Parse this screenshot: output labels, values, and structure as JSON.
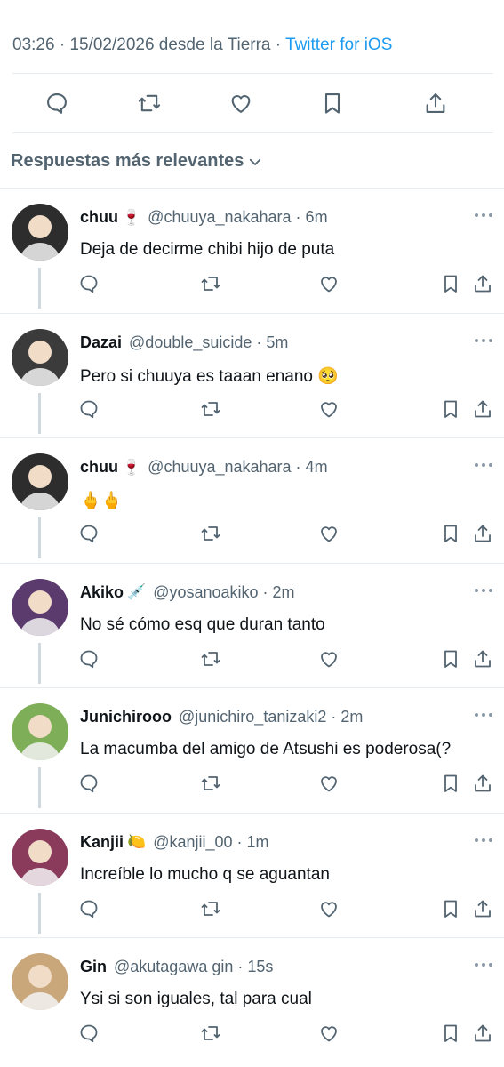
{
  "tweet": {
    "meta": "03:26 · 15/02/2026 desde la Tierra · ",
    "via": "Twitter for iOS"
  },
  "sort": {
    "label": "Respuestas más relevantes"
  },
  "icons": [
    "reply-icon",
    "retweet-icon",
    "like-icon",
    "bookmark-icon",
    "share-icon"
  ],
  "colors": {
    "accent": "#1d9bf0",
    "secondary": "#536471",
    "text": "#0f1419",
    "divider": "#e6ecf0"
  },
  "replies": [
    {
      "name": "chuu",
      "emoji": "🍷",
      "handle": "@chuuya_nakahara · 6m",
      "text": "Deja de decirme chibi hijo de puta",
      "avatar_color": "#2d2d2d"
    },
    {
      "name": "Dazai",
      "emoji": "",
      "handle": "@double_suicide · 5m",
      "text": "Pero si chuuya es taaan enano 🥺",
      "avatar_color": "#3b3b3b"
    },
    {
      "name": "chuu",
      "emoji": "🍷",
      "handle": "@chuuya_nakahara · 4m",
      "text": "🖕🖕",
      "avatar_color": "#2d2d2d"
    },
    {
      "name": "Akiko",
      "emoji": "💉",
      "handle": "@yosanoakiko · 2m",
      "text": "No sé cómo esq que duran tanto",
      "avatar_color": "#5b3a6e"
    },
    {
      "name": "Junichirooo",
      "emoji": "",
      "handle": "@junichiro_tanizaki2 · 2m",
      "text": "La macumba del amigo de Atsushi es poderosa(?",
      "avatar_color": "#7fae58"
    },
    {
      "name": "Kanjii",
      "emoji": "🍋",
      "handle": "@kanjii_00 · 1m",
      "text": "Increíble lo mucho q se aguantan",
      "avatar_color": "#8a3b5c"
    },
    {
      "name": "Gin",
      "emoji": "",
      "handle": "@akutagawa gin · 15s",
      "text": "Ysi si son iguales, tal para cual",
      "avatar_color": "#c9a77a"
    }
  ]
}
